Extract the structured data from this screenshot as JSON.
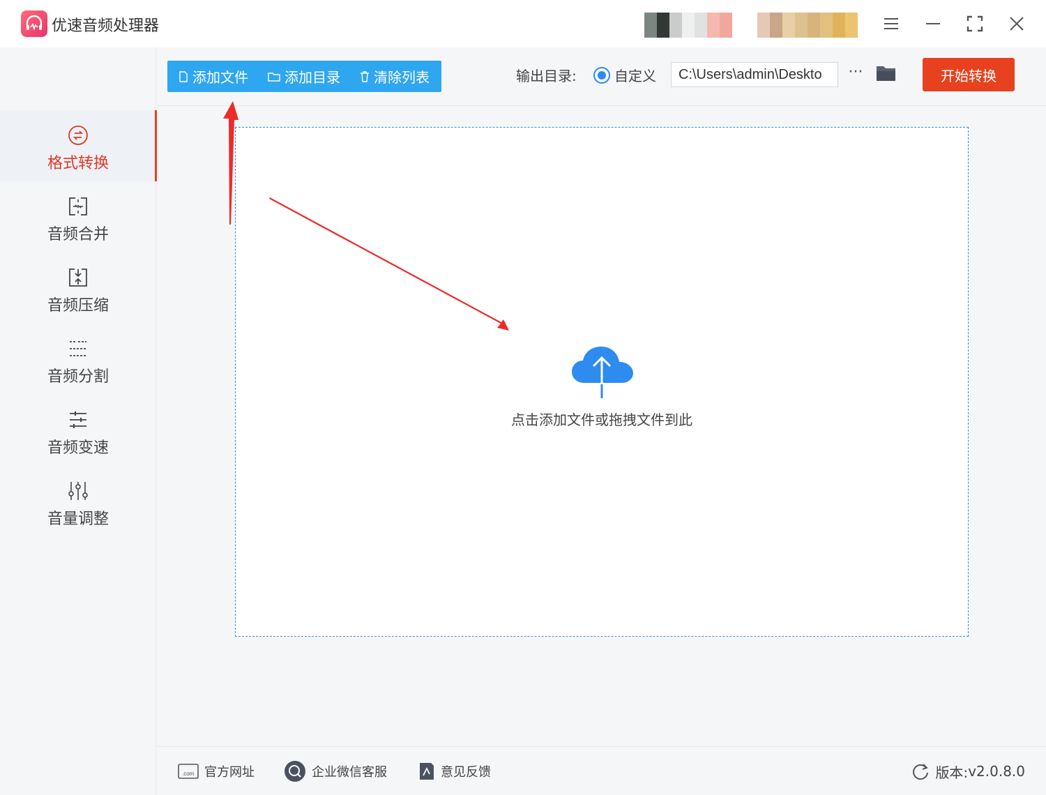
{
  "app": {
    "title": "优速音频处理器"
  },
  "window_controls": [
    "menu-icon",
    "minimize-icon",
    "maximize-icon",
    "close-icon"
  ],
  "sidebar": {
    "items": [
      {
        "label": "格式转换",
        "icon": "convert-icon",
        "active": true
      },
      {
        "label": "音频合并",
        "icon": "merge-icon",
        "active": false
      },
      {
        "label": "音频压缩",
        "icon": "compress-icon",
        "active": false
      },
      {
        "label": "音频分割",
        "icon": "split-icon",
        "active": false
      },
      {
        "label": "音频变速",
        "icon": "speed-icon",
        "active": false
      },
      {
        "label": "音量调整",
        "icon": "volume-icon",
        "active": false
      }
    ]
  },
  "toolbar": {
    "add_file_label": "添加文件",
    "add_dir_label": "添加目录",
    "clear_label": "清除列表",
    "output_label": "输出目录:",
    "output_option": "自定义",
    "output_path": "C:\\Users\\admin\\Deskto",
    "more_label": "···",
    "start_label": "开始转换"
  },
  "dropzone": {
    "text": "点击添加文件或拖拽文件到此"
  },
  "footer": {
    "site_label": "官方网址",
    "wechat_label": "企业微信客服",
    "feedback_label": "意见反馈",
    "version_label": "版本:",
    "version_value": "v2.0.8.0"
  },
  "colors": {
    "accent_blue": "#2fa6f0",
    "start_red": "#e8411f",
    "active_red": "#e03a25",
    "annotation_red": "#ee2a2a",
    "cloud_blue": "#2e8bf0"
  }
}
